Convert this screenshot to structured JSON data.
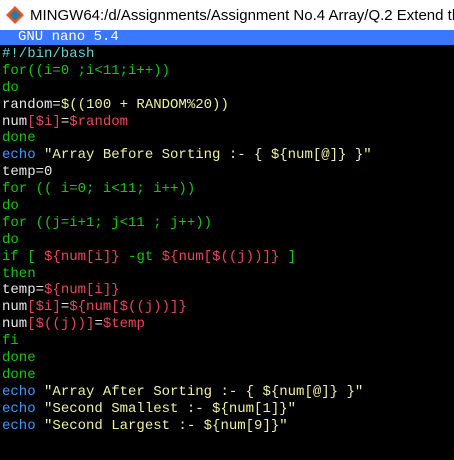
{
  "window": {
    "title": "MINGW64:/d/Assignments/Assignment No.4 Array/Q.2 Extend th"
  },
  "nano": {
    "header_label": "GNU nano 5.4"
  },
  "colors": {
    "nano_header_bg": "#3b78ff",
    "keyword": "#16c60c",
    "variable": "#e74856",
    "echo": "#3b9cff",
    "string": "#f0f0a0",
    "text": "#e8e8e8"
  },
  "code_lines": [
    [
      {
        "t": "#!/bin/bash",
        "c": "cyan"
      }
    ],
    [
      {
        "t": "for((i=0 ;i<11;i++))",
        "c": "green"
      }
    ],
    [
      {
        "t": "do",
        "c": "green"
      }
    ],
    [
      {
        "t": "random=",
        "c": "white"
      },
      {
        "t": "$((100 + RANDOM%20))",
        "c": "yellow"
      }
    ],
    [
      {
        "t": "num",
        "c": "white"
      },
      {
        "t": "[$i]",
        "c": "red"
      },
      {
        "t": "=",
        "c": "white"
      },
      {
        "t": "$random",
        "c": "red"
      }
    ],
    [
      {
        "t": "done",
        "c": "green"
      }
    ],
    [
      {
        "t": "echo",
        "c": "blue"
      },
      {
        "t": " \"Array Before Sorting :- { ${num[@]} }\"",
        "c": "yellow"
      }
    ],
    [
      {
        "t": "temp=0",
        "c": "white"
      }
    ],
    [
      {
        "t": "for (( i=0; i<11; i++))",
        "c": "green"
      }
    ],
    [
      {
        "t": "do",
        "c": "green"
      }
    ],
    [
      {
        "t": "for ((j=i+1; j<11 ; j++))",
        "c": "green"
      }
    ],
    [
      {
        "t": "do",
        "c": "green"
      }
    ],
    [
      {
        "t": "if [ ",
        "c": "green"
      },
      {
        "t": "${num[i]}",
        "c": "red"
      },
      {
        "t": " -gt ",
        "c": "green"
      },
      {
        "t": "${num[$((j))]}",
        "c": "red"
      },
      {
        "t": " ]",
        "c": "green"
      }
    ],
    [
      {
        "t": "then",
        "c": "green"
      }
    ],
    [
      {
        "t": "temp=",
        "c": "white"
      },
      {
        "t": "${num[i]}",
        "c": "red"
      }
    ],
    [
      {
        "t": "num",
        "c": "white"
      },
      {
        "t": "[$i]",
        "c": "red"
      },
      {
        "t": "=",
        "c": "white"
      },
      {
        "t": "${num[$((j))]}",
        "c": "red"
      }
    ],
    [
      {
        "t": "num",
        "c": "white"
      },
      {
        "t": "[$((j))]",
        "c": "red"
      },
      {
        "t": "=",
        "c": "white"
      },
      {
        "t": "$temp",
        "c": "red"
      }
    ],
    [
      {
        "t": "fi",
        "c": "green"
      }
    ],
    [
      {
        "t": "done",
        "c": "green"
      }
    ],
    [
      {
        "t": "done",
        "c": "green"
      }
    ],
    [
      {
        "t": "echo",
        "c": "blue"
      },
      {
        "t": " \"Array After Sorting :- { ${num[@]} }\"",
        "c": "yellow"
      }
    ],
    [
      {
        "t": "echo",
        "c": "blue"
      },
      {
        "t": " \"Second Smallest :- ${num[1]}\"",
        "c": "yellow"
      }
    ],
    [
      {
        "t": "echo",
        "c": "blue"
      },
      {
        "t": " \"Second Largest :- ${num[9]}\"",
        "c": "yellow"
      }
    ]
  ]
}
